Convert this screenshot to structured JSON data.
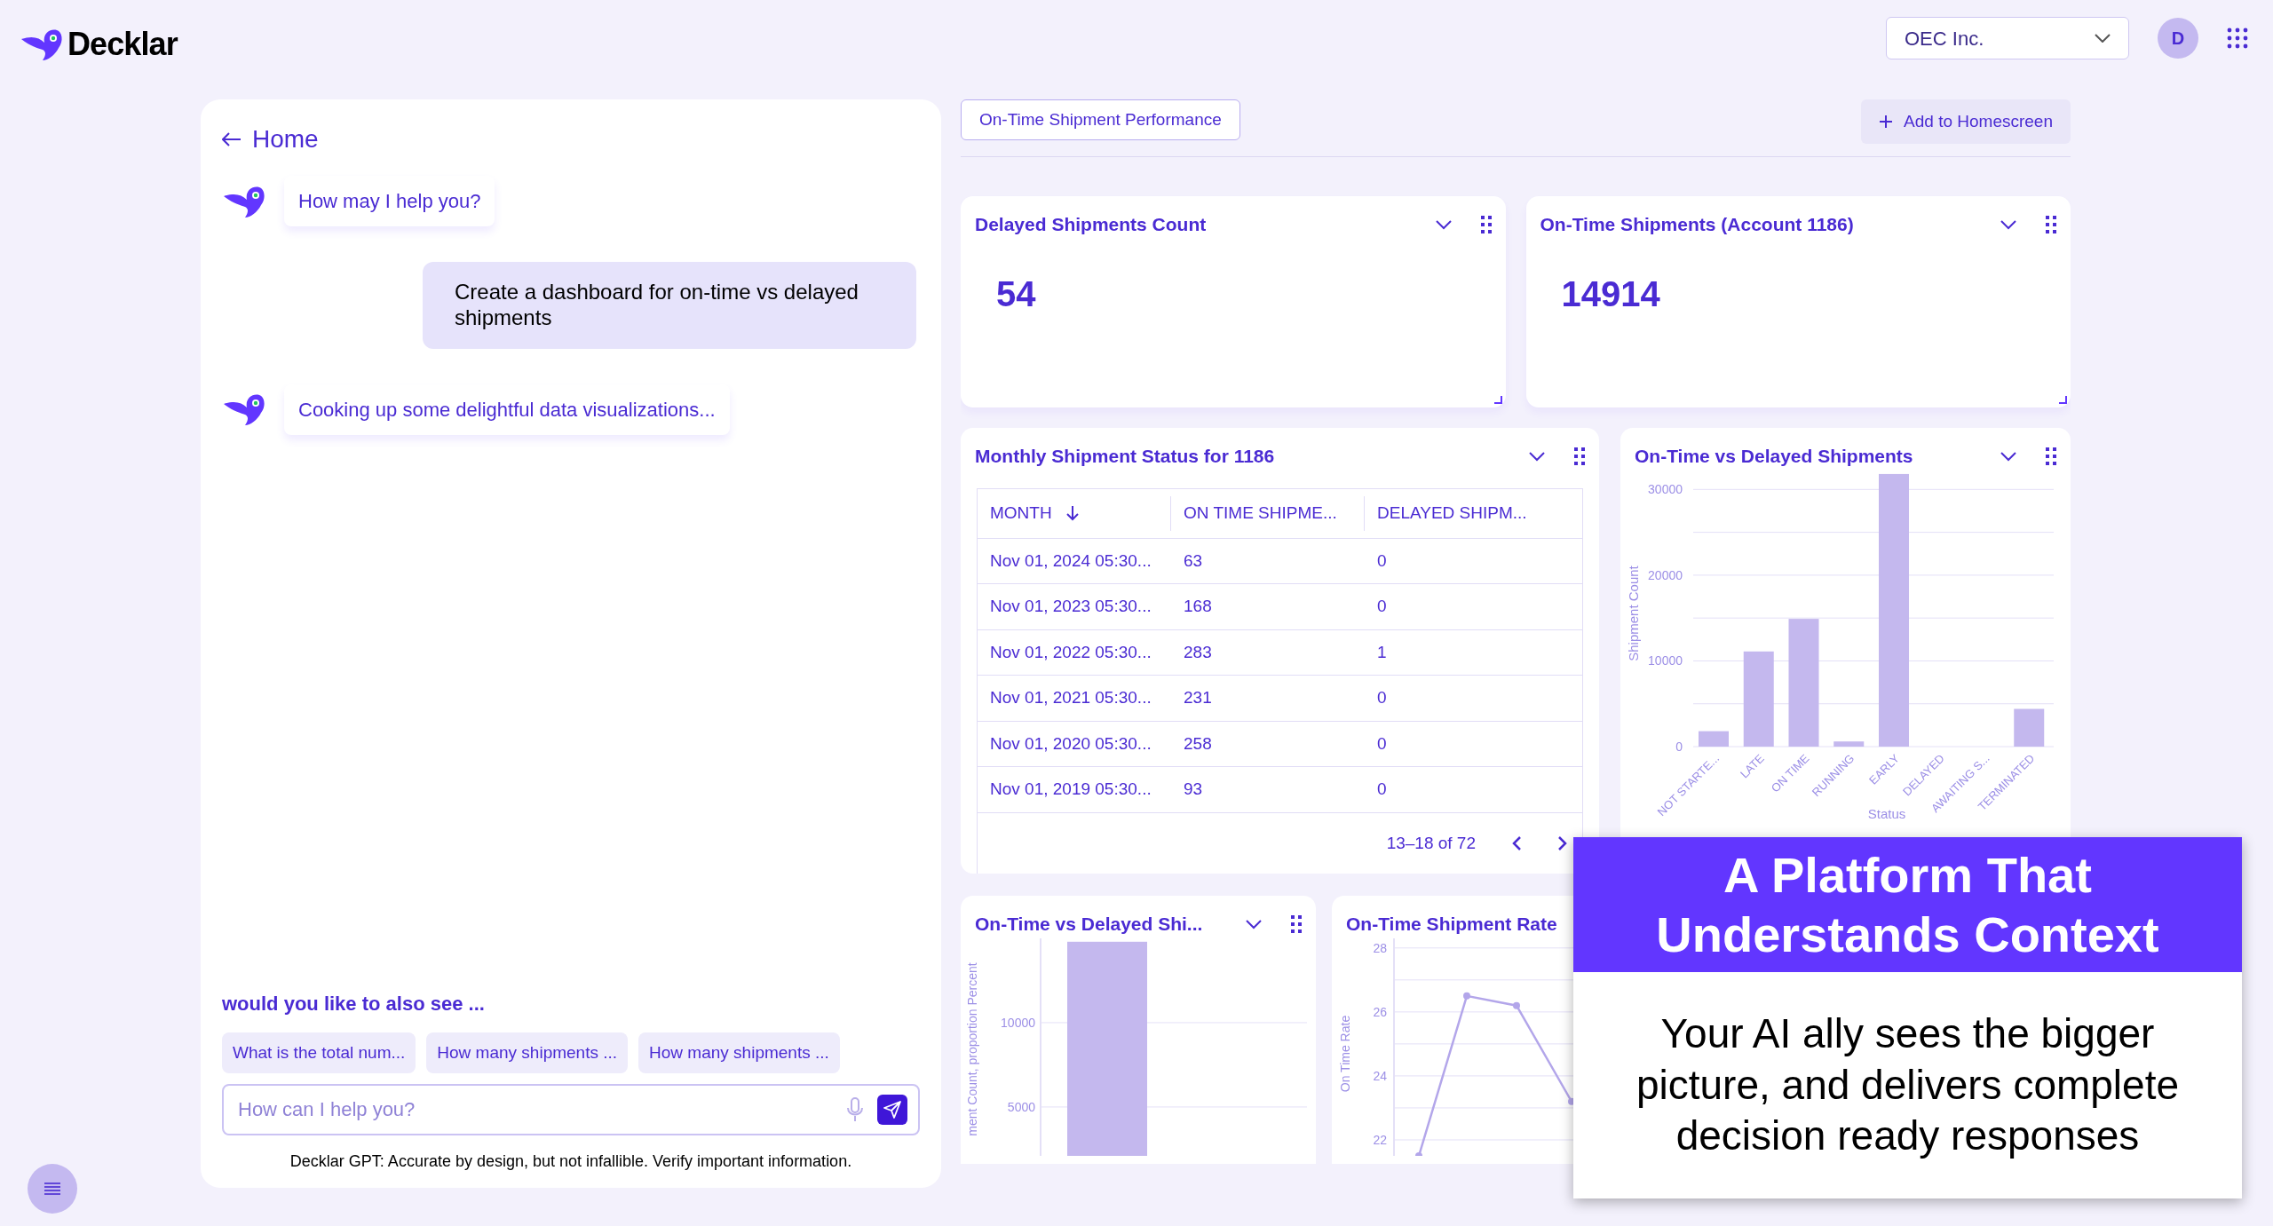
{
  "header": {
    "logo": "Decklar",
    "company_select": "OEC Inc.",
    "avatar": "D"
  },
  "chat": {
    "back_link": "Home",
    "messages": [
      {
        "kind": "bot",
        "text": "How may I help you?"
      },
      {
        "kind": "user",
        "text": "Create a dashboard for on-time vs delayed shipments"
      },
      {
        "kind": "bot",
        "text": "Cooking up some delightful data visualizations..."
      }
    ],
    "suggestions_title": "would you like to also see ...",
    "suggestions": [
      "What is the total num...",
      "How many shipments ...",
      "How many shipments ..."
    ],
    "input": {
      "placeholder": "How can I help you?"
    },
    "disclaimer": "Decklar GPT: Accurate by design, but not infallible. Verify important information."
  },
  "dashboard": {
    "title_tab": "On-Time Shipment Performance",
    "add_button": "Add to Homescreen",
    "kpis": [
      {
        "title": "Delayed Shipments Count",
        "value": "54"
      },
      {
        "title": "On-Time Shipments (Account 1186)",
        "value": "14914"
      }
    ],
    "table": {
      "title": "Monthly Shipment Status for 1186",
      "columns": [
        {
          "label": "MONTH",
          "sorted": true
        },
        {
          "label": "ON TIME SHIPME...",
          "sorted": false
        },
        {
          "label": "DELAYED SHIPM...",
          "sorted": false
        }
      ],
      "rows": [
        [
          "Nov 01, 2024 05:30...",
          "63",
          "0"
        ],
        [
          "Nov 01, 2023 05:30...",
          "168",
          "0"
        ],
        [
          "Nov 01, 2022 05:30...",
          "283",
          "1"
        ],
        [
          "Nov 01, 2021 05:30...",
          "231",
          "0"
        ],
        [
          "Nov 01, 2020 05:30...",
          "258",
          "0"
        ],
        [
          "Nov 01, 2019 05:30...",
          "93",
          "0"
        ]
      ],
      "pagination": "13–18 of 72"
    },
    "status_chart": {
      "title": "On-Time vs Delayed Shipments",
      "chart_data": {
        "type": "bar",
        "xlabel": "Status",
        "ylabel": "Shipment Count",
        "categories": [
          "NOT STARTE...",
          "LATE",
          "ON TIME",
          "RUNNING",
          "EARLY",
          "DELAYED",
          "AWAITING S...",
          "TERMINATED"
        ],
        "values": [
          1800,
          11100,
          14900,
          600,
          31800,
          0,
          0,
          4400
        ],
        "ylim": [
          0,
          32000
        ],
        "grid": true,
        "yticks": [
          0,
          10000,
          20000,
          30000
        ]
      }
    },
    "proportion_chart": {
      "title": "On-Time vs Delayed Shi...",
      "chart_data": {
        "type": "bar",
        "ylabel": "ment Count, proportion Percent",
        "values": [
          14800
        ],
        "ylim": [
          2100,
          15000
        ],
        "yticks": [
          5000,
          10000
        ]
      }
    },
    "rate_chart": {
      "title": "On-Time Shipment Rate",
      "chart_data": {
        "type": "line",
        "ylabel": "On Time Rate",
        "values": [
          21.5,
          26.5,
          26.2,
          23.2
        ],
        "ylim": [
          21.5,
          28.3
        ],
        "grid": true,
        "marker": "circle",
        "yticks": [
          22,
          24,
          26,
          28
        ]
      }
    }
  },
  "promo": {
    "title": "A Platform That Understands Context",
    "body": "Your AI ally sees the bigger picture, and delivers complete decision ready responses"
  }
}
